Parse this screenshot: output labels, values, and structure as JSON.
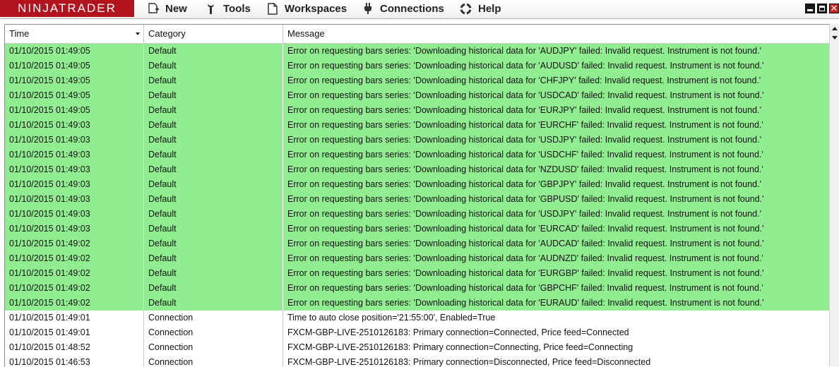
{
  "app": {
    "logo_text": "NINJATRADER",
    "brand_color": "#b2131c"
  },
  "menu": [
    {
      "name": "new",
      "icon": "new-document-icon",
      "label": "New"
    },
    {
      "name": "tools",
      "icon": "wrench-icon",
      "label": "Tools"
    },
    {
      "name": "workspaces",
      "icon": "document-icon",
      "label": "Workspaces"
    },
    {
      "name": "connections",
      "icon": "plug-icon",
      "label": "Connections"
    },
    {
      "name": "help",
      "icon": "lifebuoy-icon",
      "label": "Help"
    }
  ],
  "window_controls": {
    "close_glyph": "✕"
  },
  "log": {
    "columns": [
      "Time",
      "Category",
      "Message"
    ],
    "sort_column": "Time",
    "error_row_color": "#90ee90",
    "rows": [
      {
        "time": "01/10/2015 01:49:05",
        "category": "Default",
        "message": "Error on requesting bars series: 'Downloading historical data for 'AUDJPY' failed: Invalid request. Instrument is not found.'",
        "highlight": true
      },
      {
        "time": "01/10/2015 01:49:05",
        "category": "Default",
        "message": "Error on requesting bars series: 'Downloading historical data for 'AUDUSD' failed: Invalid request. Instrument is not found.'",
        "highlight": true
      },
      {
        "time": "01/10/2015 01:49:05",
        "category": "Default",
        "message": "Error on requesting bars series: 'Downloading historical data for 'CHFJPY' failed: Invalid request. Instrument is not found.'",
        "highlight": true
      },
      {
        "time": "01/10/2015 01:49:05",
        "category": "Default",
        "message": "Error on requesting bars series: 'Downloading historical data for 'USDCAD' failed: Invalid request. Instrument is not found.'",
        "highlight": true
      },
      {
        "time": "01/10/2015 01:49:05",
        "category": "Default",
        "message": "Error on requesting bars series: 'Downloading historical data for 'EURJPY' failed: Invalid request. Instrument is not found.'",
        "highlight": true
      },
      {
        "time": "01/10/2015 01:49:03",
        "category": "Default",
        "message": "Error on requesting bars series: 'Downloading historical data for 'EURCHF' failed: Invalid request. Instrument is not found.'",
        "highlight": true
      },
      {
        "time": "01/10/2015 01:49:03",
        "category": "Default",
        "message": "Error on requesting bars series: 'Downloading historical data for 'USDJPY' failed: Invalid request. Instrument is not found.'",
        "highlight": true
      },
      {
        "time": "01/10/2015 01:49:03",
        "category": "Default",
        "message": "Error on requesting bars series: 'Downloading historical data for 'USDCHF' failed: Invalid request. Instrument is not found.'",
        "highlight": true
      },
      {
        "time": "01/10/2015 01:49:03",
        "category": "Default",
        "message": "Error on requesting bars series: 'Downloading historical data for 'NZDUSD' failed: Invalid request. Instrument is not found.'",
        "highlight": true
      },
      {
        "time": "01/10/2015 01:49:03",
        "category": "Default",
        "message": "Error on requesting bars series: 'Downloading historical data for 'GBPJPY' failed: Invalid request. Instrument is not found.'",
        "highlight": true
      },
      {
        "time": "01/10/2015 01:49:03",
        "category": "Default",
        "message": "Error on requesting bars series: 'Downloading historical data for 'GBPUSD' failed: Invalid request. Instrument is not found.'",
        "highlight": true
      },
      {
        "time": "01/10/2015 01:49:03",
        "category": "Default",
        "message": "Error on requesting bars series: 'Downloading historical data for 'USDJPY' failed: Invalid request. Instrument is not found.'",
        "highlight": true
      },
      {
        "time": "01/10/2015 01:49:03",
        "category": "Default",
        "message": "Error on requesting bars series: 'Downloading historical data for 'EURCAD' failed: Invalid request. Instrument is not found.'",
        "highlight": true
      },
      {
        "time": "01/10/2015 01:49:02",
        "category": "Default",
        "message": "Error on requesting bars series: 'Downloading historical data for 'AUDCAD' failed: Invalid request. Instrument is not found.'",
        "highlight": true
      },
      {
        "time": "01/10/2015 01:49:02",
        "category": "Default",
        "message": "Error on requesting bars series: 'Downloading historical data for 'AUDNZD' failed: Invalid request. Instrument is not found.'",
        "highlight": true
      },
      {
        "time": "01/10/2015 01:49:02",
        "category": "Default",
        "message": "Error on requesting bars series: 'Downloading historical data for 'EURGBP' failed: Invalid request. Instrument is not found.'",
        "highlight": true
      },
      {
        "time": "01/10/2015 01:49:02",
        "category": "Default",
        "message": "Error on requesting bars series: 'Downloading historical data for 'GBPCHF' failed: Invalid request. Instrument is not found.'",
        "highlight": true
      },
      {
        "time": "01/10/2015 01:49:02",
        "category": "Default",
        "message": "Error on requesting bars series: 'Downloading historical data for 'EURAUD' failed: Invalid request. Instrument is not found.'",
        "highlight": true
      },
      {
        "time": "01/10/2015 01:49:01",
        "category": "Connection",
        "message": "Time to auto close position='21:55:00', Enabled=True",
        "highlight": false
      },
      {
        "time": "01/10/2015 01:49:01",
        "category": "Connection",
        "message": "FXCM-GBP-LIVE-2510126183: Primary connection=Connected, Price feed=Connected",
        "highlight": false
      },
      {
        "time": "01/10/2015 01:48:52",
        "category": "Connection",
        "message": "FXCM-GBP-LIVE-2510126183: Primary connection=Connecting, Price feed=Connecting",
        "highlight": false
      },
      {
        "time": "01/10/2015 01:46:53",
        "category": "Connection",
        "message": "FXCM-GBP-LIVE-2510126183: Primary connection=Disconnected, Price feed=Disconnected",
        "highlight": false
      }
    ]
  }
}
